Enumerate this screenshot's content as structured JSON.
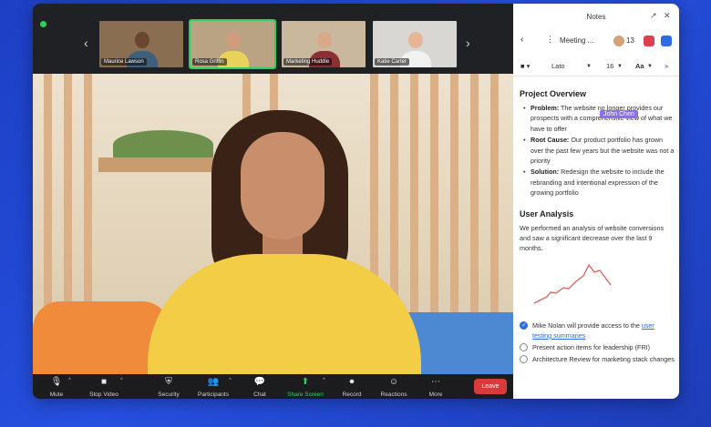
{
  "participants": [
    {
      "name": "Maurice Lawson",
      "active": false,
      "bg": "#8a6e52",
      "skin": "#6b4630",
      "shirt": "#3f5f7a"
    },
    {
      "name": "Rosa Griffin",
      "active": true,
      "bg": "#b9a383",
      "skin": "#d19c7d",
      "shirt": "#e9d25a"
    },
    {
      "name": "Marketing Huddle",
      "active": false,
      "bg": "#c9b89d",
      "skin": "#d9a888",
      "shirt": "#8b2f35"
    },
    {
      "name": "Katie Carter",
      "active": false,
      "bg": "#d9d7d3",
      "skin": "#e5b596",
      "shirt": "#f1f1f1"
    }
  ],
  "toolbar": {
    "mute": {
      "label": "Mute",
      "icon": "microphone-icon"
    },
    "stop_video": {
      "label": "Stop Video",
      "icon": "video-camera-icon"
    },
    "security": {
      "label": "Security",
      "icon": "shield-icon"
    },
    "participants": {
      "label": "Participants",
      "icon": "people-icon"
    },
    "chat": {
      "label": "Chat",
      "icon": "chat-bubble-icon"
    },
    "share_screen": {
      "label": "Share Screen",
      "icon": "share-arrow-icon"
    },
    "record": {
      "label": "Record",
      "icon": "record-icon"
    },
    "reactions": {
      "label": "Reactions",
      "icon": "smiley-add-icon"
    },
    "more": {
      "label": "More",
      "icon": "ellipsis-icon"
    },
    "leave": "Leave"
  },
  "notes": {
    "title": "Notes",
    "doc_title": "Meeting ...",
    "viewer_count": "13",
    "font_name": "Lato",
    "font_size": "16",
    "text_style": "Aa",
    "section1_title": "Project Overview",
    "bullets": [
      {
        "label": "Problem:",
        "text": " The website no longer provides our prospects with a comprehensive view of what we have to offer"
      },
      {
        "label": "Root Cause:",
        "text": " Our product portfolio has grown over the past few years but the website was not a priority"
      },
      {
        "label": "Solution:",
        "text": " Redesign the website to include the rebranding and intentional expression of the growing portfolio"
      }
    ],
    "collaborator_cursor": "John Chen",
    "section2_title": "User Analysis",
    "analysis_text": "We performed an analysis of website conversions and saw a significant decrease over the last 9 months.",
    "tasks": [
      {
        "text": "Mike Nolan will provide access to the ",
        "link": "user testing summaries",
        "checked": true
      },
      {
        "text": "Present action items for leadership (FRI)",
        "link": "",
        "checked": false
      },
      {
        "text": "Architecture Review for marketing stack changes",
        "link": "",
        "checked": false
      }
    ]
  },
  "colors": {
    "active_green": "#2fcf5e",
    "leave_red": "#d93a3a",
    "link_blue": "#2d6ae3",
    "cursor_purple": "#8c6ef0",
    "sparkline": "#e0605a"
  }
}
